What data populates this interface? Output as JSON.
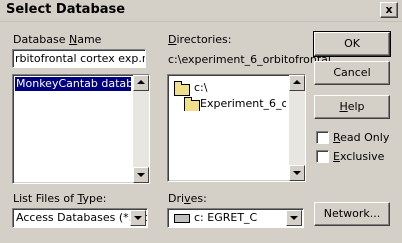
{
  "window": {
    "title": "Select Database",
    "close_glyph": "x"
  },
  "database_name": {
    "label_pre": "Database ",
    "label_mnemonic": "N",
    "label_post": "ame",
    "value": "rbitofrontal cortex exp.mdb",
    "list_items": [
      "MonkeyCantab databas"
    ]
  },
  "directories": {
    "label_mnemonic": "D",
    "label_post": "irectories:",
    "path": "c:\\experiment_6_orbitofrontal",
    "tree": [
      "c:\\",
      "Experiment_6_orbito"
    ]
  },
  "file_type": {
    "label_pre": "List Files of ",
    "label_mnemonic": "T",
    "label_post": "ype:",
    "value": "Access Databases (*.mc"
  },
  "drives": {
    "label_pre": "Dri",
    "label_mnemonic": "v",
    "label_post": "es:",
    "value": "c: EGRET_C"
  },
  "buttons": {
    "ok": "OK",
    "cancel": "Cancel",
    "help_mnemonic": "H",
    "help_post": "elp",
    "network": "Network..."
  },
  "options": {
    "read_only_mnemonic": "R",
    "read_only_post": "ead Only",
    "exclusive_mnemonic": "E",
    "exclusive_post": "xclusive"
  },
  "icons": {
    "folder": "folder-icon",
    "drive": "drive-icon"
  }
}
